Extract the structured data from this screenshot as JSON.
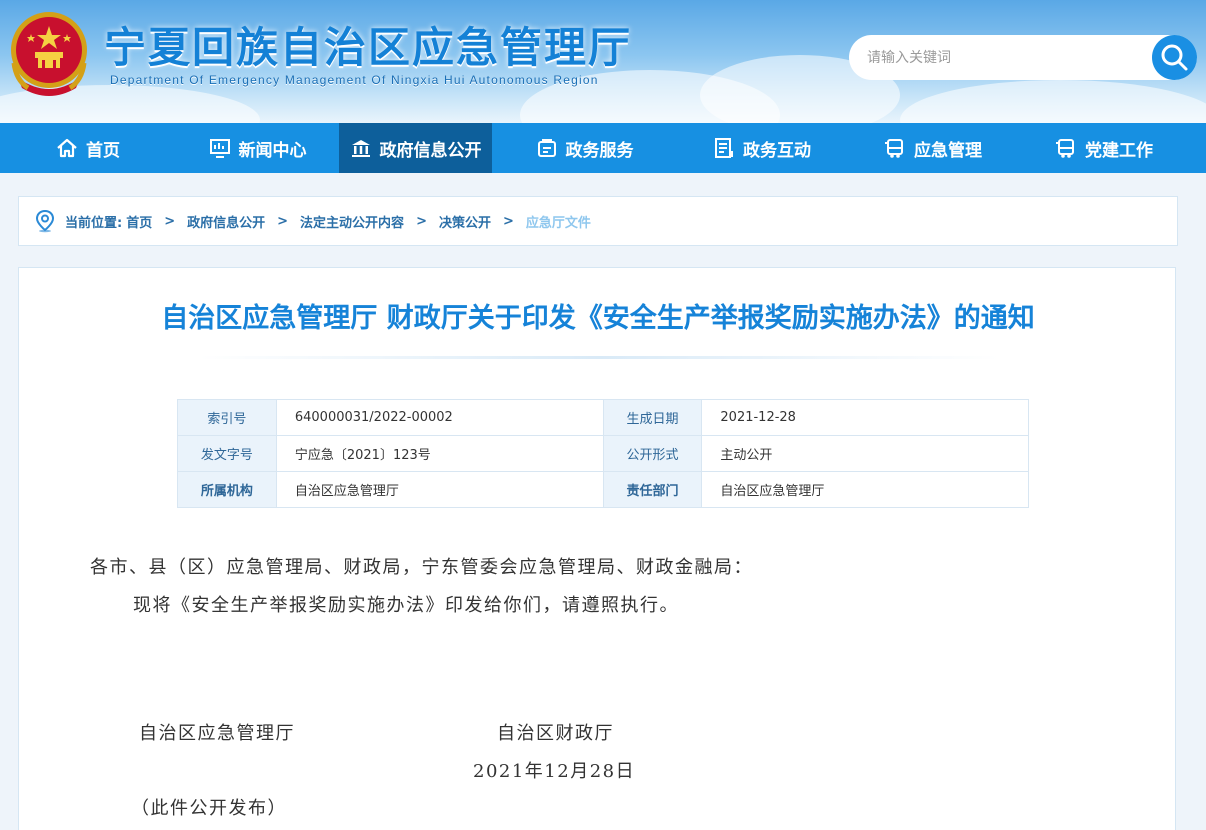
{
  "header": {
    "title": "宁夏回族自治区应急管理厅",
    "subtitle": "Department Of Emergency Management Of Ningxia Hui Autonomous Region",
    "emblem_icon": "national-emblem-icon"
  },
  "search": {
    "placeholder": "请输入关键词",
    "icon": "search-icon"
  },
  "nav": {
    "items": [
      {
        "label": "首页",
        "icon": "home-icon"
      },
      {
        "label": "新闻中心",
        "icon": "news-icon"
      },
      {
        "label": "政府信息公开",
        "icon": "government-building-icon"
      },
      {
        "label": "政务服务",
        "icon": "service-icon"
      },
      {
        "label": "政务互动",
        "icon": "interaction-icon"
      },
      {
        "label": "应急管理",
        "icon": "bus-icon"
      },
      {
        "label": "党建工作",
        "icon": "party-icon"
      }
    ],
    "active_index": 2
  },
  "breadcrumb": {
    "label": "当前位置:",
    "items": [
      "首页",
      "政府信息公开",
      "法定主动公开内容",
      "决策公开",
      "应急厅文件"
    ],
    "separator": ">"
  },
  "document": {
    "title": "自治区应急管理厅 财政厅关于印发《安全生产举报奖励实施办法》的通知",
    "meta": [
      [
        {
          "key": "索引号",
          "value": "640000031/2022-00002"
        },
        {
          "key": "生成日期",
          "value": "2021-12-28"
        }
      ],
      [
        {
          "key": "发文字号",
          "value": "宁应急〔2021〕123号"
        },
        {
          "key": "公开形式",
          "value": "主动公开"
        }
      ],
      [
        {
          "key": "所属机构",
          "value": "自治区应急管理厅"
        },
        {
          "key": "责任部门",
          "value": "自治区应急管理厅"
        }
      ]
    ],
    "addressee": "各市、县（区）应急管理局、财政局，宁东管委会应急管理局、财政金融局：",
    "body": "现将《安全生产举报奖励实施办法》印发给你们，请遵照执行。",
    "signer_1": "自治区应急管理厅",
    "signer_2": "自治区财政厅",
    "date": "2021年12月28日",
    "note": "（此件公开发布）"
  },
  "colors": {
    "nav_bg": "#1790e2",
    "nav_active": "#0d5f9b",
    "title_blue": "#1683d8",
    "breadcrumb_current": "#8fc7ee"
  }
}
